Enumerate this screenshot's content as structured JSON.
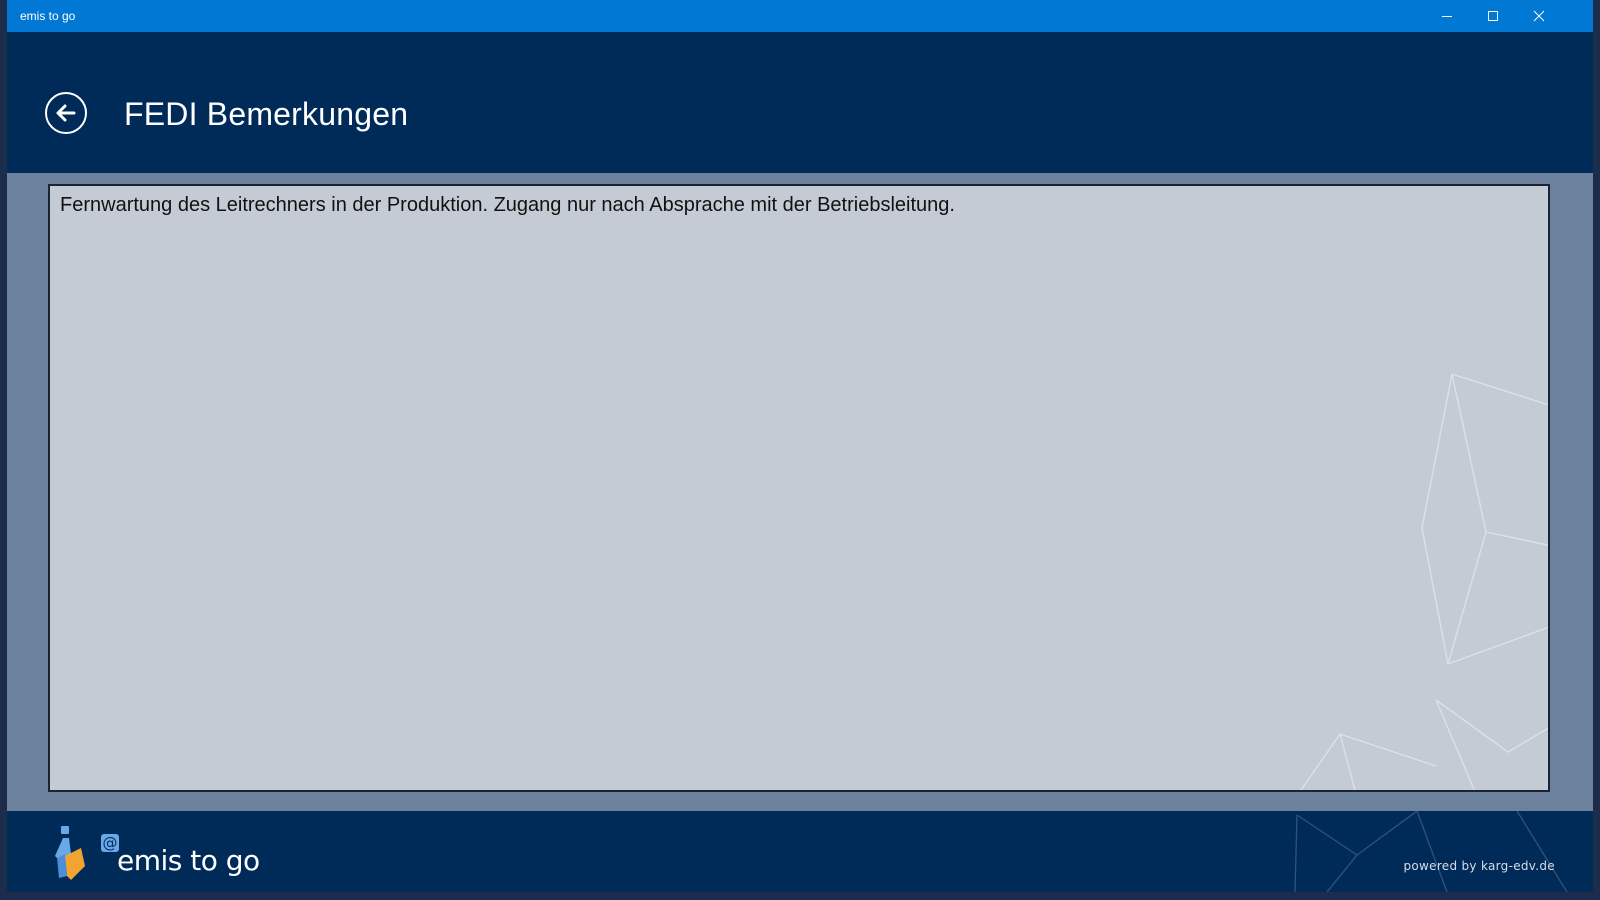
{
  "window": {
    "app_title": "emis to go",
    "controls": [
      "minimize",
      "maximize",
      "close"
    ]
  },
  "header": {
    "title": "FEDI Bemerkungen",
    "back_icon": "back-arrow-circle-icon"
  },
  "notes": {
    "text": "Fernwartung des Leitrechners in der Produktion. Zugang nur nach Absprache mit der Betriebsleitung."
  },
  "footer": {
    "brand_name": "emis to go",
    "powered_by": "powered by karg-edv.de"
  },
  "colors": {
    "titlebar": "#0078d4",
    "header_bg": "#002b59",
    "content_bg": "#6c819e",
    "notes_bg": "#c5cbd5"
  }
}
